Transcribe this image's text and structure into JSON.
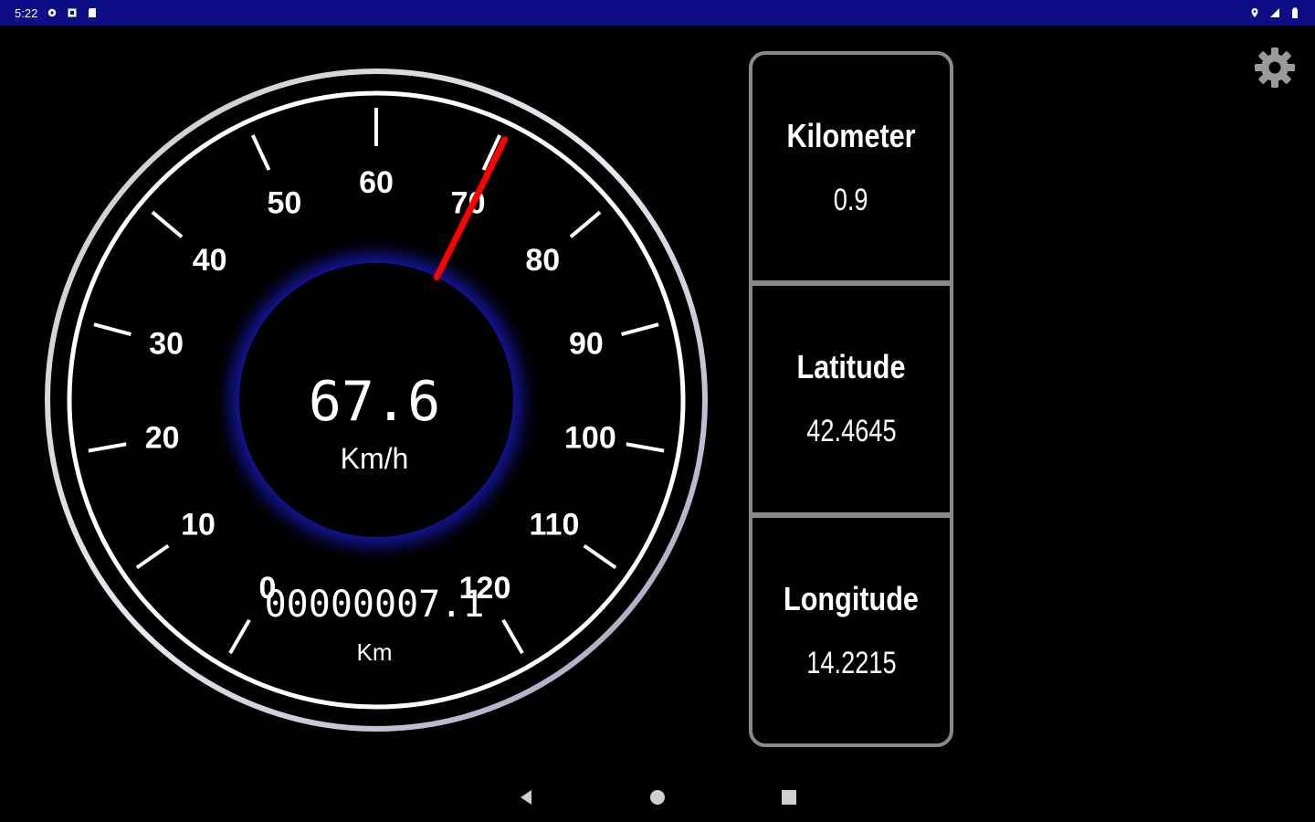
{
  "status_bar": {
    "time": "5:22",
    "left_icons": [
      "settings-icon",
      "square-notification-icon",
      "sd-card-icon"
    ],
    "right_icons": [
      "location-icon",
      "signal-icon",
      "battery-icon"
    ],
    "background": "#0d0d86"
  },
  "speedometer": {
    "speed": "67.6",
    "speed_unit": "Km/h",
    "odometer": "00000007.1",
    "odometer_unit": "Km",
    "needle_value": 70.5,
    "needle_color": "#ff0000",
    "glow_color": "#1c1ccf",
    "scale_min": 0,
    "scale_max": 120,
    "tick_labels": [
      "0",
      "10",
      "20",
      "30",
      "40",
      "50",
      "60",
      "70",
      "80",
      "90",
      "100",
      "110",
      "120"
    ]
  },
  "info_panel": {
    "cards": [
      {
        "label": "Kilometer",
        "value": "0.9"
      },
      {
        "label": "Latitude",
        "value": "42.4645"
      },
      {
        "label": "Longitude",
        "value": "14.2215"
      }
    ],
    "border_color": "#8a8a8a"
  },
  "settings_button": {
    "icon": "gear-icon"
  },
  "nav_bar": {
    "buttons": [
      "back-icon",
      "home-icon",
      "recents-icon"
    ]
  }
}
